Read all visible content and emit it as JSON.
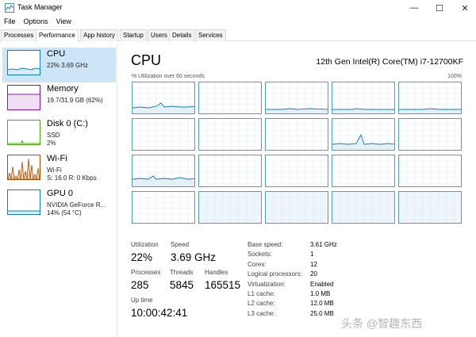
{
  "window": {
    "title": "Task Manager",
    "buttons": {
      "minimize": "—",
      "maximize": "☐",
      "close": "✕"
    }
  },
  "menu": [
    "File",
    "Options",
    "View"
  ],
  "tabs": [
    "Processes",
    "Performance",
    "App history",
    "Startup",
    "Users",
    "Details",
    "Services"
  ],
  "active_tab": "Performance",
  "sidebar": {
    "items": [
      {
        "title": "CPU",
        "lines": [
          "22%  3.69 GHz"
        ],
        "color": "#117dbb"
      },
      {
        "title": "Memory",
        "lines": [
          "19.7/31.9 GB (62%)"
        ],
        "color": "#8b12ae"
      },
      {
        "title": "Disk 0 (C:)",
        "lines": [
          "SSD",
          "2%"
        ],
        "color": "#4da60c"
      },
      {
        "title": "Wi-Fi",
        "lines": [
          "Wi-Fi",
          "S: 16.0  R: 0 Kbps"
        ],
        "color": "#a74f01"
      },
      {
        "title": "GPU 0",
        "lines": [
          "NVIDIA GeForce R...",
          "14% (54 °C)"
        ],
        "color": "#117dbb"
      }
    ]
  },
  "main": {
    "title": "CPU",
    "model": "12th Gen Intel(R) Core(TM) i7-12700KF",
    "util_label": "% Utilization over 60 seconds",
    "util_max": "100%"
  },
  "stats": {
    "utilization": {
      "label": "Utilization",
      "value": "22%"
    },
    "speed": {
      "label": "Speed",
      "value": "3.69 GHz"
    },
    "processes": {
      "label": "Processes",
      "value": "285"
    },
    "threads": {
      "label": "Threads",
      "value": "5845"
    },
    "handles": {
      "label": "Handles",
      "value": "165515"
    },
    "uptime": {
      "label": "Up time",
      "value": "10:00:42:41"
    }
  },
  "info": [
    {
      "label": "Base speed:",
      "value": "3.61 GHz"
    },
    {
      "label": "Sockets:",
      "value": "1"
    },
    {
      "label": "Cores:",
      "value": "12"
    },
    {
      "label": "Logical processors:",
      "value": "20"
    },
    {
      "label": "Virtualization:",
      "value": "Enabled"
    },
    {
      "label": "L1 cache:",
      "value": "1.0 MB"
    },
    {
      "label": "L2 cache:",
      "value": "12.0 MB"
    },
    {
      "label": "L3 cache:",
      "value": "25.0 MB"
    }
  ],
  "watermark": "头条 @智趣东西"
}
